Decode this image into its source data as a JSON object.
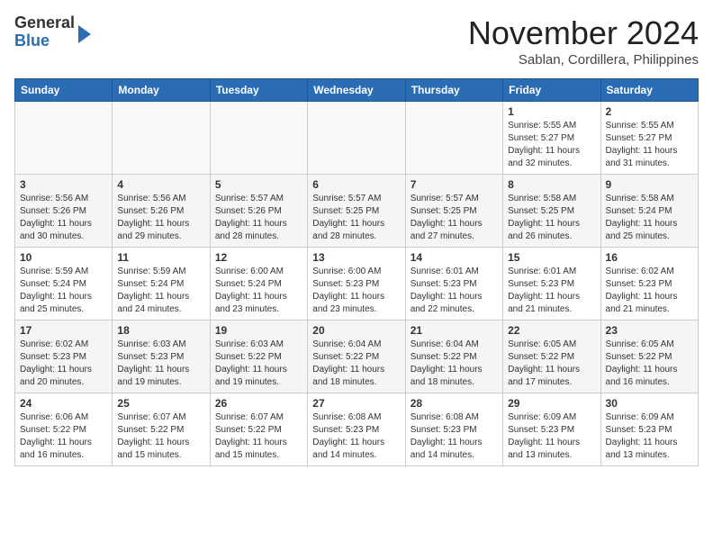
{
  "header": {
    "logo_general": "General",
    "logo_blue": "Blue",
    "month_title": "November 2024",
    "location": "Sablan, Cordillera, Philippines"
  },
  "days_of_week": [
    "Sunday",
    "Monday",
    "Tuesday",
    "Wednesday",
    "Thursday",
    "Friday",
    "Saturday"
  ],
  "weeks": [
    [
      {
        "day": "",
        "info": ""
      },
      {
        "day": "",
        "info": ""
      },
      {
        "day": "",
        "info": ""
      },
      {
        "day": "",
        "info": ""
      },
      {
        "day": "",
        "info": ""
      },
      {
        "day": "1",
        "info": "Sunrise: 5:55 AM\nSunset: 5:27 PM\nDaylight: 11 hours and 32 minutes."
      },
      {
        "day": "2",
        "info": "Sunrise: 5:55 AM\nSunset: 5:27 PM\nDaylight: 11 hours and 31 minutes."
      }
    ],
    [
      {
        "day": "3",
        "info": "Sunrise: 5:56 AM\nSunset: 5:26 PM\nDaylight: 11 hours and 30 minutes."
      },
      {
        "day": "4",
        "info": "Sunrise: 5:56 AM\nSunset: 5:26 PM\nDaylight: 11 hours and 29 minutes."
      },
      {
        "day": "5",
        "info": "Sunrise: 5:57 AM\nSunset: 5:26 PM\nDaylight: 11 hours and 28 minutes."
      },
      {
        "day": "6",
        "info": "Sunrise: 5:57 AM\nSunset: 5:25 PM\nDaylight: 11 hours and 28 minutes."
      },
      {
        "day": "7",
        "info": "Sunrise: 5:57 AM\nSunset: 5:25 PM\nDaylight: 11 hours and 27 minutes."
      },
      {
        "day": "8",
        "info": "Sunrise: 5:58 AM\nSunset: 5:25 PM\nDaylight: 11 hours and 26 minutes."
      },
      {
        "day": "9",
        "info": "Sunrise: 5:58 AM\nSunset: 5:24 PM\nDaylight: 11 hours and 25 minutes."
      }
    ],
    [
      {
        "day": "10",
        "info": "Sunrise: 5:59 AM\nSunset: 5:24 PM\nDaylight: 11 hours and 25 minutes."
      },
      {
        "day": "11",
        "info": "Sunrise: 5:59 AM\nSunset: 5:24 PM\nDaylight: 11 hours and 24 minutes."
      },
      {
        "day": "12",
        "info": "Sunrise: 6:00 AM\nSunset: 5:24 PM\nDaylight: 11 hours and 23 minutes."
      },
      {
        "day": "13",
        "info": "Sunrise: 6:00 AM\nSunset: 5:23 PM\nDaylight: 11 hours and 23 minutes."
      },
      {
        "day": "14",
        "info": "Sunrise: 6:01 AM\nSunset: 5:23 PM\nDaylight: 11 hours and 22 minutes."
      },
      {
        "day": "15",
        "info": "Sunrise: 6:01 AM\nSunset: 5:23 PM\nDaylight: 11 hours and 21 minutes."
      },
      {
        "day": "16",
        "info": "Sunrise: 6:02 AM\nSunset: 5:23 PM\nDaylight: 11 hours and 21 minutes."
      }
    ],
    [
      {
        "day": "17",
        "info": "Sunrise: 6:02 AM\nSunset: 5:23 PM\nDaylight: 11 hours and 20 minutes."
      },
      {
        "day": "18",
        "info": "Sunrise: 6:03 AM\nSunset: 5:23 PM\nDaylight: 11 hours and 19 minutes."
      },
      {
        "day": "19",
        "info": "Sunrise: 6:03 AM\nSunset: 5:22 PM\nDaylight: 11 hours and 19 minutes."
      },
      {
        "day": "20",
        "info": "Sunrise: 6:04 AM\nSunset: 5:22 PM\nDaylight: 11 hours and 18 minutes."
      },
      {
        "day": "21",
        "info": "Sunrise: 6:04 AM\nSunset: 5:22 PM\nDaylight: 11 hours and 18 minutes."
      },
      {
        "day": "22",
        "info": "Sunrise: 6:05 AM\nSunset: 5:22 PM\nDaylight: 11 hours and 17 minutes."
      },
      {
        "day": "23",
        "info": "Sunrise: 6:05 AM\nSunset: 5:22 PM\nDaylight: 11 hours and 16 minutes."
      }
    ],
    [
      {
        "day": "24",
        "info": "Sunrise: 6:06 AM\nSunset: 5:22 PM\nDaylight: 11 hours and 16 minutes."
      },
      {
        "day": "25",
        "info": "Sunrise: 6:07 AM\nSunset: 5:22 PM\nDaylight: 11 hours and 15 minutes."
      },
      {
        "day": "26",
        "info": "Sunrise: 6:07 AM\nSunset: 5:22 PM\nDaylight: 11 hours and 15 minutes."
      },
      {
        "day": "27",
        "info": "Sunrise: 6:08 AM\nSunset: 5:23 PM\nDaylight: 11 hours and 14 minutes."
      },
      {
        "day": "28",
        "info": "Sunrise: 6:08 AM\nSunset: 5:23 PM\nDaylight: 11 hours and 14 minutes."
      },
      {
        "day": "29",
        "info": "Sunrise: 6:09 AM\nSunset: 5:23 PM\nDaylight: 11 hours and 13 minutes."
      },
      {
        "day": "30",
        "info": "Sunrise: 6:09 AM\nSunset: 5:23 PM\nDaylight: 11 hours and 13 minutes."
      }
    ]
  ]
}
